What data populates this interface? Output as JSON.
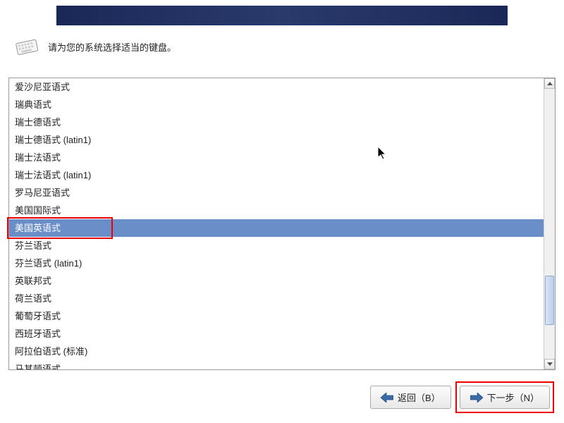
{
  "instruction": "请为您的系统选择适当的键盘。",
  "keyboard_layouts": [
    {
      "label": "爱沙尼亚语式",
      "selected": false
    },
    {
      "label": "瑞典语式",
      "selected": false
    },
    {
      "label": "瑞士德语式",
      "selected": false
    },
    {
      "label": "瑞士德语式 (latin1)",
      "selected": false
    },
    {
      "label": "瑞士法语式",
      "selected": false
    },
    {
      "label": "瑞士法语式 (latin1)",
      "selected": false
    },
    {
      "label": "罗马尼亚语式",
      "selected": false
    },
    {
      "label": "美国国际式",
      "selected": false
    },
    {
      "label": "美国英语式",
      "selected": true
    },
    {
      "label": "芬兰语式",
      "selected": false
    },
    {
      "label": "芬兰语式 (latin1)",
      "selected": false
    },
    {
      "label": "英联邦式",
      "selected": false
    },
    {
      "label": "荷兰语式",
      "selected": false
    },
    {
      "label": "葡萄牙语式",
      "selected": false
    },
    {
      "label": "西班牙语式",
      "selected": false
    },
    {
      "label": "阿拉伯语式 (标准)",
      "selected": false
    },
    {
      "label": "马其顿语式",
      "selected": false
    }
  ],
  "buttons": {
    "back": "返回（B）",
    "next": "下一步（N）"
  },
  "highlights": {
    "selected_item": true,
    "next_button": true
  }
}
